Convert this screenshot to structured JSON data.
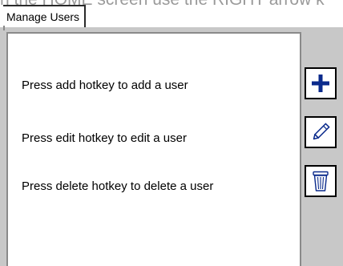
{
  "header": {
    "caption": "n the HOME screen use the RIGHT arrow k"
  },
  "tab": {
    "label": "Manage Users"
  },
  "instructions": [
    "Press add hotkey to add a user",
    "Press edit hotkey to edit a user",
    "Press delete hotkey to delete a user"
  ],
  "hotkeys": [
    {
      "icon": "plus-icon",
      "color": "#0a2a8c"
    },
    {
      "icon": "pencil-icon",
      "color": "#0a2a8c"
    },
    {
      "icon": "trash-can-icon",
      "color": "#0a2a8c"
    }
  ]
}
